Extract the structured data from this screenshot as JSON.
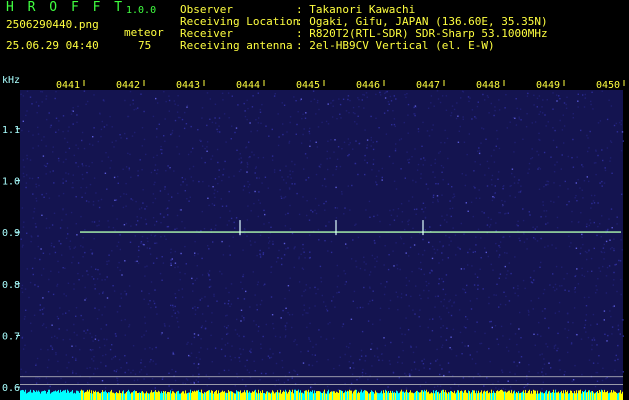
{
  "header": {
    "app_title": "H R O F F T",
    "version": "1.0.0",
    "filename": "2506290440.png",
    "datetime": "25.06.29 04:40",
    "meteor_label": "meteor",
    "meteor_count": "75",
    "info": [
      {
        "label": "Observer",
        "value": ": Takanori Kawachi"
      },
      {
        "label": "Receiving Location",
        "value": ": Ogaki, Gifu, JAPAN (136.60E, 35.35N)"
      },
      {
        "label": "Receiver",
        "value": ": R820T2(RTL-SDR) SDR-Sharp 53.1000MHz"
      },
      {
        "label": "Receiving antenna",
        "value": ": 2el-HB9CV Vertical (el. E-W)"
      }
    ]
  },
  "colors": {
    "background": "#000000",
    "spectrogram_noise": "#1a1a5c",
    "header_text": "#ffff40",
    "time_labels": "#ffff40",
    "frequency_labels": "#aaffff",
    "title_green": "#40ff40",
    "carrier_line": "#b0ffb0",
    "level_cyan": "#00ffff",
    "level_yellow": "#ffff00"
  },
  "chart_data": {
    "type": "heatmap",
    "y_unit_label": "kHz",
    "y_ticks": [
      "1.1",
      "1.0",
      "0.9",
      "0.8",
      "0.7",
      "0.6"
    ],
    "y_tick_values": [
      1.1,
      1.0,
      0.9,
      0.8,
      0.7,
      0.6
    ],
    "ylim": [
      0.575,
      1.175
    ],
    "x_ticks": [
      "0441",
      "0442",
      "0443",
      "0444",
      "0445",
      "0446",
      "0447",
      "0448",
      "0449",
      "0450"
    ],
    "carrier_frequency": 0.9,
    "carrier_start_label": "0441",
    "meteor_events": [
      {
        "time": "0444",
        "frequency": 0.9
      },
      {
        "time": "0445.6",
        "frequency": 0.9
      },
      {
        "time": "0447.05",
        "frequency": 0.9
      }
    ],
    "reference_lines_khz": [
      0.62,
      0.605
    ]
  }
}
